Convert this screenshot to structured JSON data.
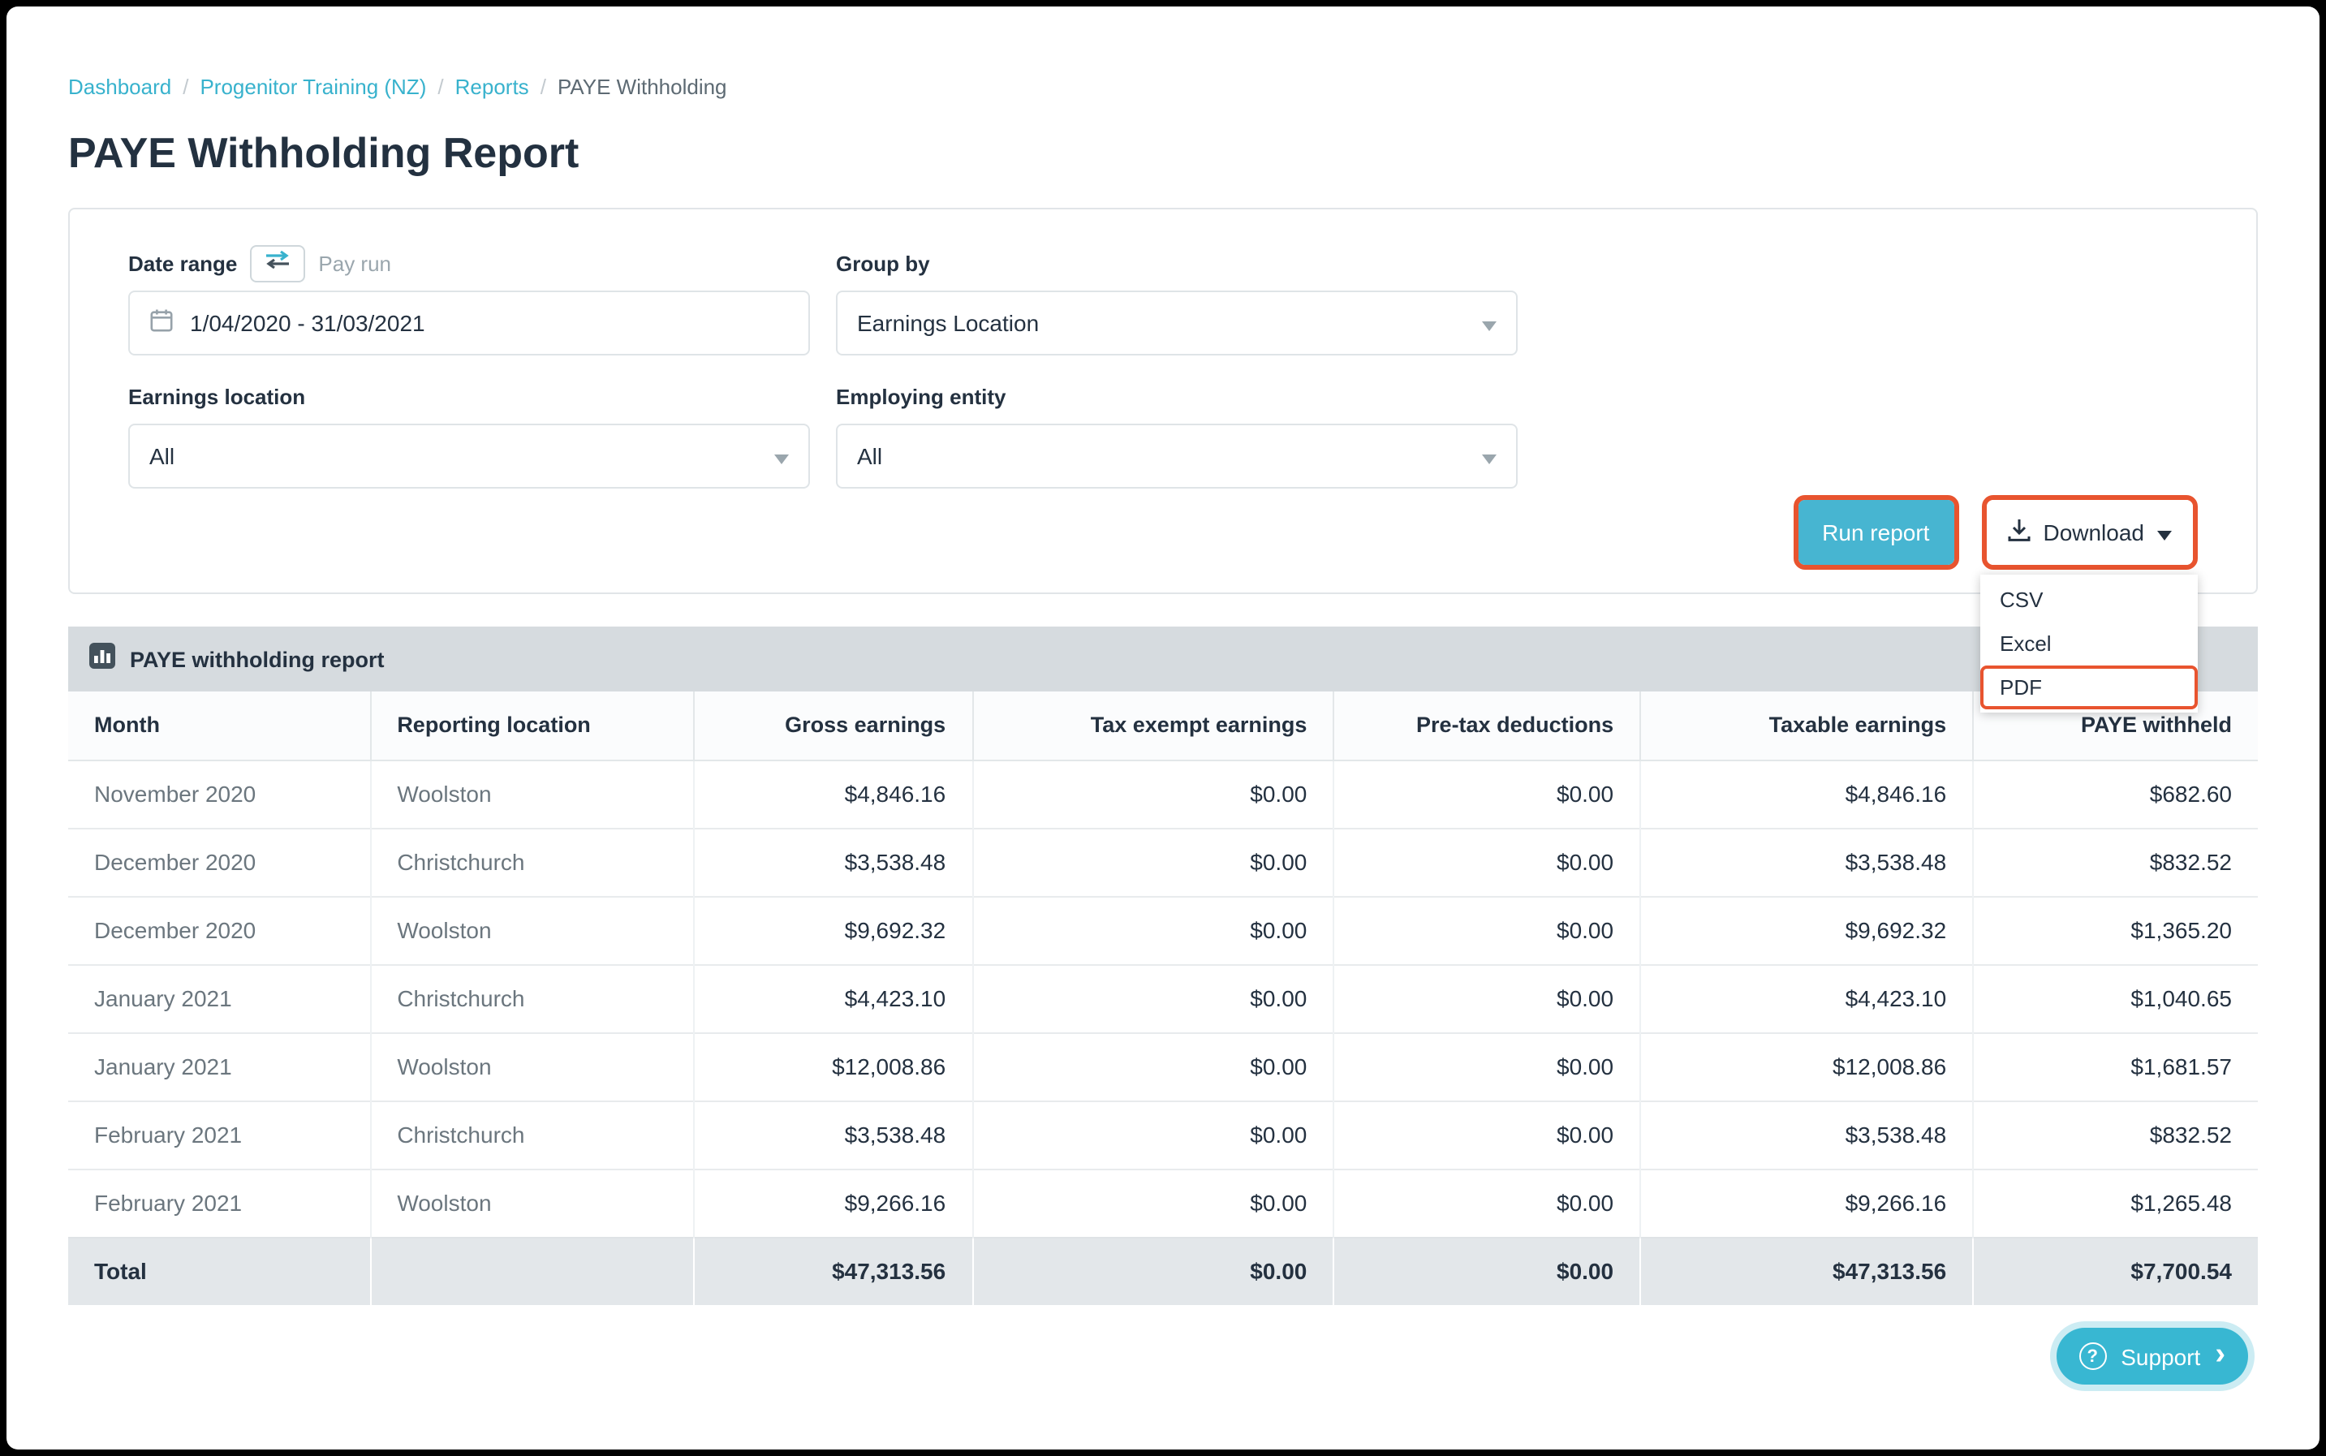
{
  "breadcrumb": {
    "separator": "/",
    "items": [
      {
        "label": "Dashboard"
      },
      {
        "label": "Progenitor Training (NZ)"
      },
      {
        "label": "Reports"
      },
      {
        "label": "PAYE Withholding"
      }
    ]
  },
  "page": {
    "title": "PAYE Withholding Report"
  },
  "filters": {
    "date_range_label": "Date range",
    "pay_run_label": "Pay run",
    "date_range_value": "1/04/2020 - 31/03/2021",
    "group_by_label": "Group by",
    "group_by_value": "Earnings Location",
    "earnings_location_label": "Earnings location",
    "earnings_location_value": "All",
    "employing_entity_label": "Employing entity",
    "employing_entity_value": "All",
    "run_report_label": "Run report",
    "download_label": "Download",
    "download_menu": [
      "CSV",
      "Excel",
      "PDF"
    ],
    "highlighted_menu_item": "PDF"
  },
  "report": {
    "title": "PAYE withholding report",
    "columns": [
      "Month",
      "Reporting location",
      "Gross earnings",
      "Tax exempt earnings",
      "Pre-tax deductions",
      "Taxable earnings",
      "PAYE withheld"
    ],
    "rows": [
      [
        "November 2020",
        "Woolston",
        "$4,846.16",
        "$0.00",
        "$0.00",
        "$4,846.16",
        "$682.60"
      ],
      [
        "December 2020",
        "Christchurch",
        "$3,538.48",
        "$0.00",
        "$0.00",
        "$3,538.48",
        "$832.52"
      ],
      [
        "December 2020",
        "Woolston",
        "$9,692.32",
        "$0.00",
        "$0.00",
        "$9,692.32",
        "$1,365.20"
      ],
      [
        "January 2021",
        "Christchurch",
        "$4,423.10",
        "$0.00",
        "$0.00",
        "$4,423.10",
        "$1,040.65"
      ],
      [
        "January 2021",
        "Woolston",
        "$12,008.86",
        "$0.00",
        "$0.00",
        "$12,008.86",
        "$1,681.57"
      ],
      [
        "February 2021",
        "Christchurch",
        "$3,538.48",
        "$0.00",
        "$0.00",
        "$3,538.48",
        "$832.52"
      ],
      [
        "February 2021",
        "Woolston",
        "$9,266.16",
        "$0.00",
        "$0.00",
        "$9,266.16",
        "$1,265.48"
      ]
    ],
    "total": {
      "label": "Total",
      "values": [
        "$47,313.56",
        "$0.00",
        "$0.00",
        "$47,313.56",
        "$7,700.54"
      ]
    }
  },
  "support": {
    "label": "Support"
  },
  "colors": {
    "accent_teal": "#38b2cd",
    "highlight_orange": "#e8542f",
    "heading_navy": "#233140"
  },
  "icons": {
    "swap": "swap-arrows-icon",
    "calendar": "calendar-icon",
    "download": "download-icon",
    "caret": "chevron-down-icon",
    "report": "bar-chart-icon",
    "help": "question-mark-icon",
    "chevron_right": "chevron-right-icon"
  }
}
